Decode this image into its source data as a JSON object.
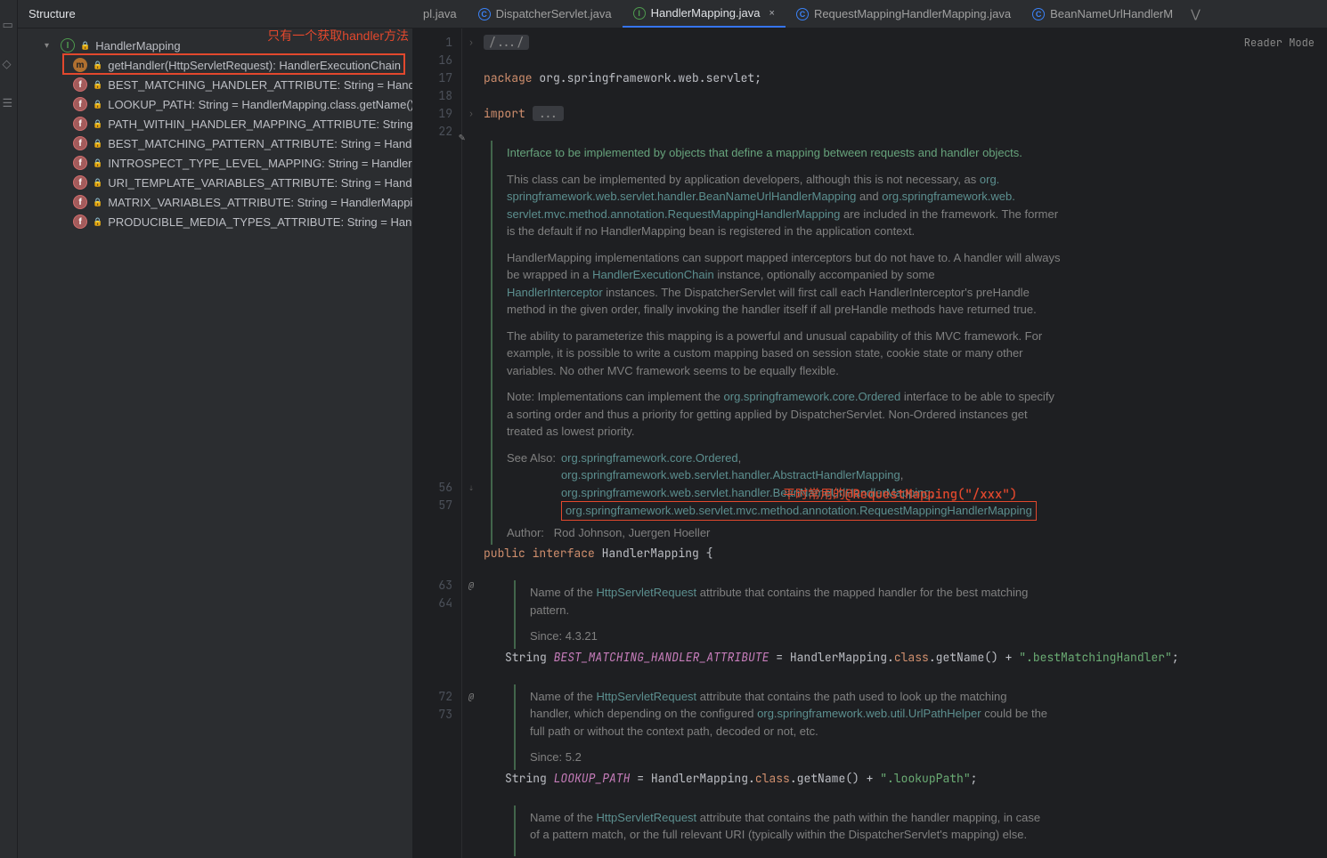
{
  "panel": {
    "title": "Structure"
  },
  "annotations": {
    "top": "只有一个获取handler方法",
    "bottom": "平时常用的@RequestMapping(\"/xxx\")"
  },
  "structure": {
    "root": "HandlerMapping",
    "items": [
      "getHandler(HttpServletRequest): HandlerExecutionChain",
      "BEST_MATCHING_HANDLER_ATTRIBUTE: String = HandlerMapp",
      "LOOKUP_PATH: String = HandlerMapping.class.getName() + \".",
      "PATH_WITHIN_HANDLER_MAPPING_ATTRIBUTE: String = Hand",
      "BEST_MATCHING_PATTERN_ATTRIBUTE: String = HandlerMapp",
      "INTROSPECT_TYPE_LEVEL_MAPPING: String = HandlerMappin",
      "URI_TEMPLATE_VARIABLES_ATTRIBUTE: String = HandlerMapp",
      "MATRIX_VARIABLES_ATTRIBUTE: String = HandlerMapping.clas",
      "PRODUCIBLE_MEDIA_TYPES_ATTRIBUTE: String = HandlerMap"
    ]
  },
  "tabs": {
    "t0": "pl.java",
    "t1": "DispatcherServlet.java",
    "t2": "HandlerMapping.java",
    "t3": "RequestMappingHandlerMapping.java",
    "t4": "BeanNameUrlHandlerM"
  },
  "reader": "Reader Mode",
  "gutter": {
    "l1": "1",
    "l16": "16",
    "l17": "17",
    "l18": "18",
    "l19": "19",
    "l22": "22",
    "l56": "56",
    "l57": "57",
    "l63": "63",
    "l64": "64",
    "l72": "72",
    "l73": "73"
  },
  "code": {
    "pkg_kw": "package",
    "pkg": " org.springframework.web.servlet;",
    "imp_kw": "import",
    "doc_intro": "Interface to be implemented by objects that define a mapping between requests and handler objects.",
    "doc_p2a": "This class can be implemented by application developers, although this is not necessary, as ",
    "doc_p2_l1": "org.",
    "doc_p2_l2": "springframework.web.servlet.handler.BeanNameUrlHandlerMapping",
    "doc_p2b": " and ",
    "doc_p2_l3": "org.springframework.web.",
    "doc_p2_l4": "servlet.mvc.method.annotation.RequestMappingHandlerMapping",
    "doc_p2c": " are included in the framework. The former is the default if no HandlerMapping bean is registered in the application context.",
    "doc_p3a": "HandlerMapping implementations can support mapped interceptors but do not have to. A handler will always be wrapped in a ",
    "doc_p3_l1": "HandlerExecutionChain",
    "doc_p3b": " instance, optionally accompanied by some ",
    "doc_p3_l2": "HandlerInterceptor",
    "doc_p3c": " instances. The DispatcherServlet will first call each HandlerInterceptor's preHandle method in the given order, finally invoking the handler itself if all preHandle methods have returned true.",
    "doc_p4": "The ability to parameterize this mapping is a powerful and unusual capability of this MVC framework. For example, it is possible to write a custom mapping based on session state, cookie state or many other variables. No other MVC framework seems to be equally flexible.",
    "doc_p5a": "Note: Implementations can implement the ",
    "doc_p5_l1": "org.springframework.core.Ordered",
    "doc_p5b": " interface to be able to specify a sorting order and thus a priority for getting applied by DispatcherServlet. Non-Ordered instances get treated as lowest priority.",
    "see_label": "See Also:",
    "see1": "org.springframework.core.Ordered",
    "see2": "org.springframework.web.servlet.handler.AbstractHandlerMapping",
    "see3": "org.springframework.web.servlet.handler.BeanNameUrlHandlerMapping",
    "see4": "org.springframework.web.servlet.mvc.method.annotation.RequestMappingHandlerMapping",
    "author_label": "Author:",
    "author": "Rod Johnson, Juergen Hoeller",
    "decl_pub": "public ",
    "decl_int": "interface ",
    "decl_name": "HandlerMapping",
    "decl_brace": " {",
    "doc1a": "Name of the ",
    "doc1_link": "HttpServletRequest",
    "doc1b": " attribute that contains the mapped handler for the best matching pattern.",
    "since1": "Since: 4.3.21",
    "line63a": "String ",
    "line63b": "BEST_MATCHING_HANDLER_ATTRIBUTE",
    "line63c": " = HandlerMapping.",
    "line63d": "class",
    "line63e": ".getName() + ",
    "line63f": "\".bestMatchingHandler\"",
    "line63g": ";",
    "doc2a": "Name of the ",
    "doc2_link": "HttpServletRequest",
    "doc2b": " attribute that contains the path used to look up the matching handler, which depending on the configured ",
    "doc2_link2": "org.springframework.web.util.UrlPathHelper",
    "doc2c": " could be the full path or without the context path, decoded or not, etc.",
    "since2": "Since: 5.2",
    "line72a": "String ",
    "line72b": "LOOKUP_PATH",
    "line72c": " = HandlerMapping.",
    "line72d": "class",
    "line72e": ".getName() + ",
    "line72f": "\".lookupPath\"",
    "line72g": ";",
    "doc3a": "Name of the ",
    "doc3_link": "HttpServletRequest",
    "doc3b": " attribute that contains the path within the handler mapping, in case of a pattern match, or the full relevant URI (typically within the DispatcherServlet's mapping) else."
  }
}
